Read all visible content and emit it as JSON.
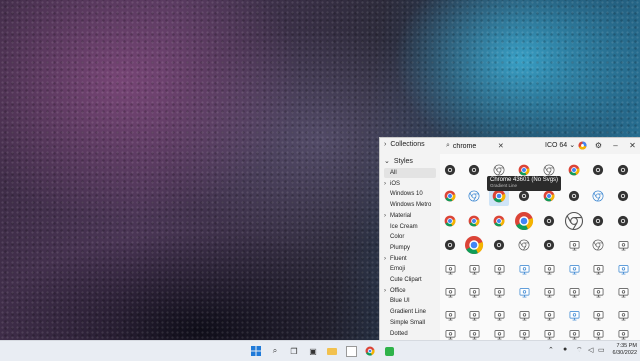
{
  "window": {
    "collections_label": "Collections",
    "search": {
      "value": "chrome",
      "placeholder": ""
    },
    "size_label": "ICO 64",
    "controls": [
      "color-icon",
      "gear-icon",
      "minimize-icon",
      "close-icon"
    ]
  },
  "sidebar": {
    "styles_label": "Styles",
    "items": [
      {
        "label": "All",
        "chevron": false,
        "active": true
      },
      {
        "label": "iOS",
        "chevron": true,
        "active": false
      },
      {
        "label": "Windows 10",
        "chevron": false,
        "active": false
      },
      {
        "label": "Windows Metro",
        "chevron": false,
        "active": false
      },
      {
        "label": "Material",
        "chevron": true,
        "active": false
      },
      {
        "label": "Ice Cream",
        "chevron": false,
        "active": false
      },
      {
        "label": "Color",
        "chevron": false,
        "active": false
      },
      {
        "label": "Plumpy",
        "chevron": false,
        "active": false
      },
      {
        "label": "Fluent",
        "chevron": true,
        "active": false
      },
      {
        "label": "Emoji",
        "chevron": false,
        "active": false
      },
      {
        "label": "Cute Clipart",
        "chevron": false,
        "active": false
      },
      {
        "label": "Office",
        "chevron": true,
        "active": false
      },
      {
        "label": "Blue UI",
        "chevron": false,
        "active": false
      },
      {
        "label": "Gradient Line",
        "chevron": false,
        "active": false
      },
      {
        "label": "Simple Small",
        "chevron": false,
        "active": false
      },
      {
        "label": "Dotted",
        "chevron": false,
        "active": false
      }
    ]
  },
  "tooltip": {
    "title": "Chrome 43601 (No Svgs)",
    "subtitle": "Gradient Line"
  },
  "taskbar": {
    "time": "7:35 PM",
    "date": "6/30/2022",
    "apps": [
      "windows-start-icon",
      "search-icon",
      "task-view-icon",
      "chat-icon",
      "file-explorer-icon",
      "store-icon",
      "chrome-icon",
      "app-icon"
    ]
  },
  "colors": {
    "accent": "#2e7fcf",
    "chrome_red": "#db4437",
    "chrome_yellow": "#f4b400",
    "chrome_green": "#0f9d58",
    "chrome_blue": "#4285f4"
  }
}
